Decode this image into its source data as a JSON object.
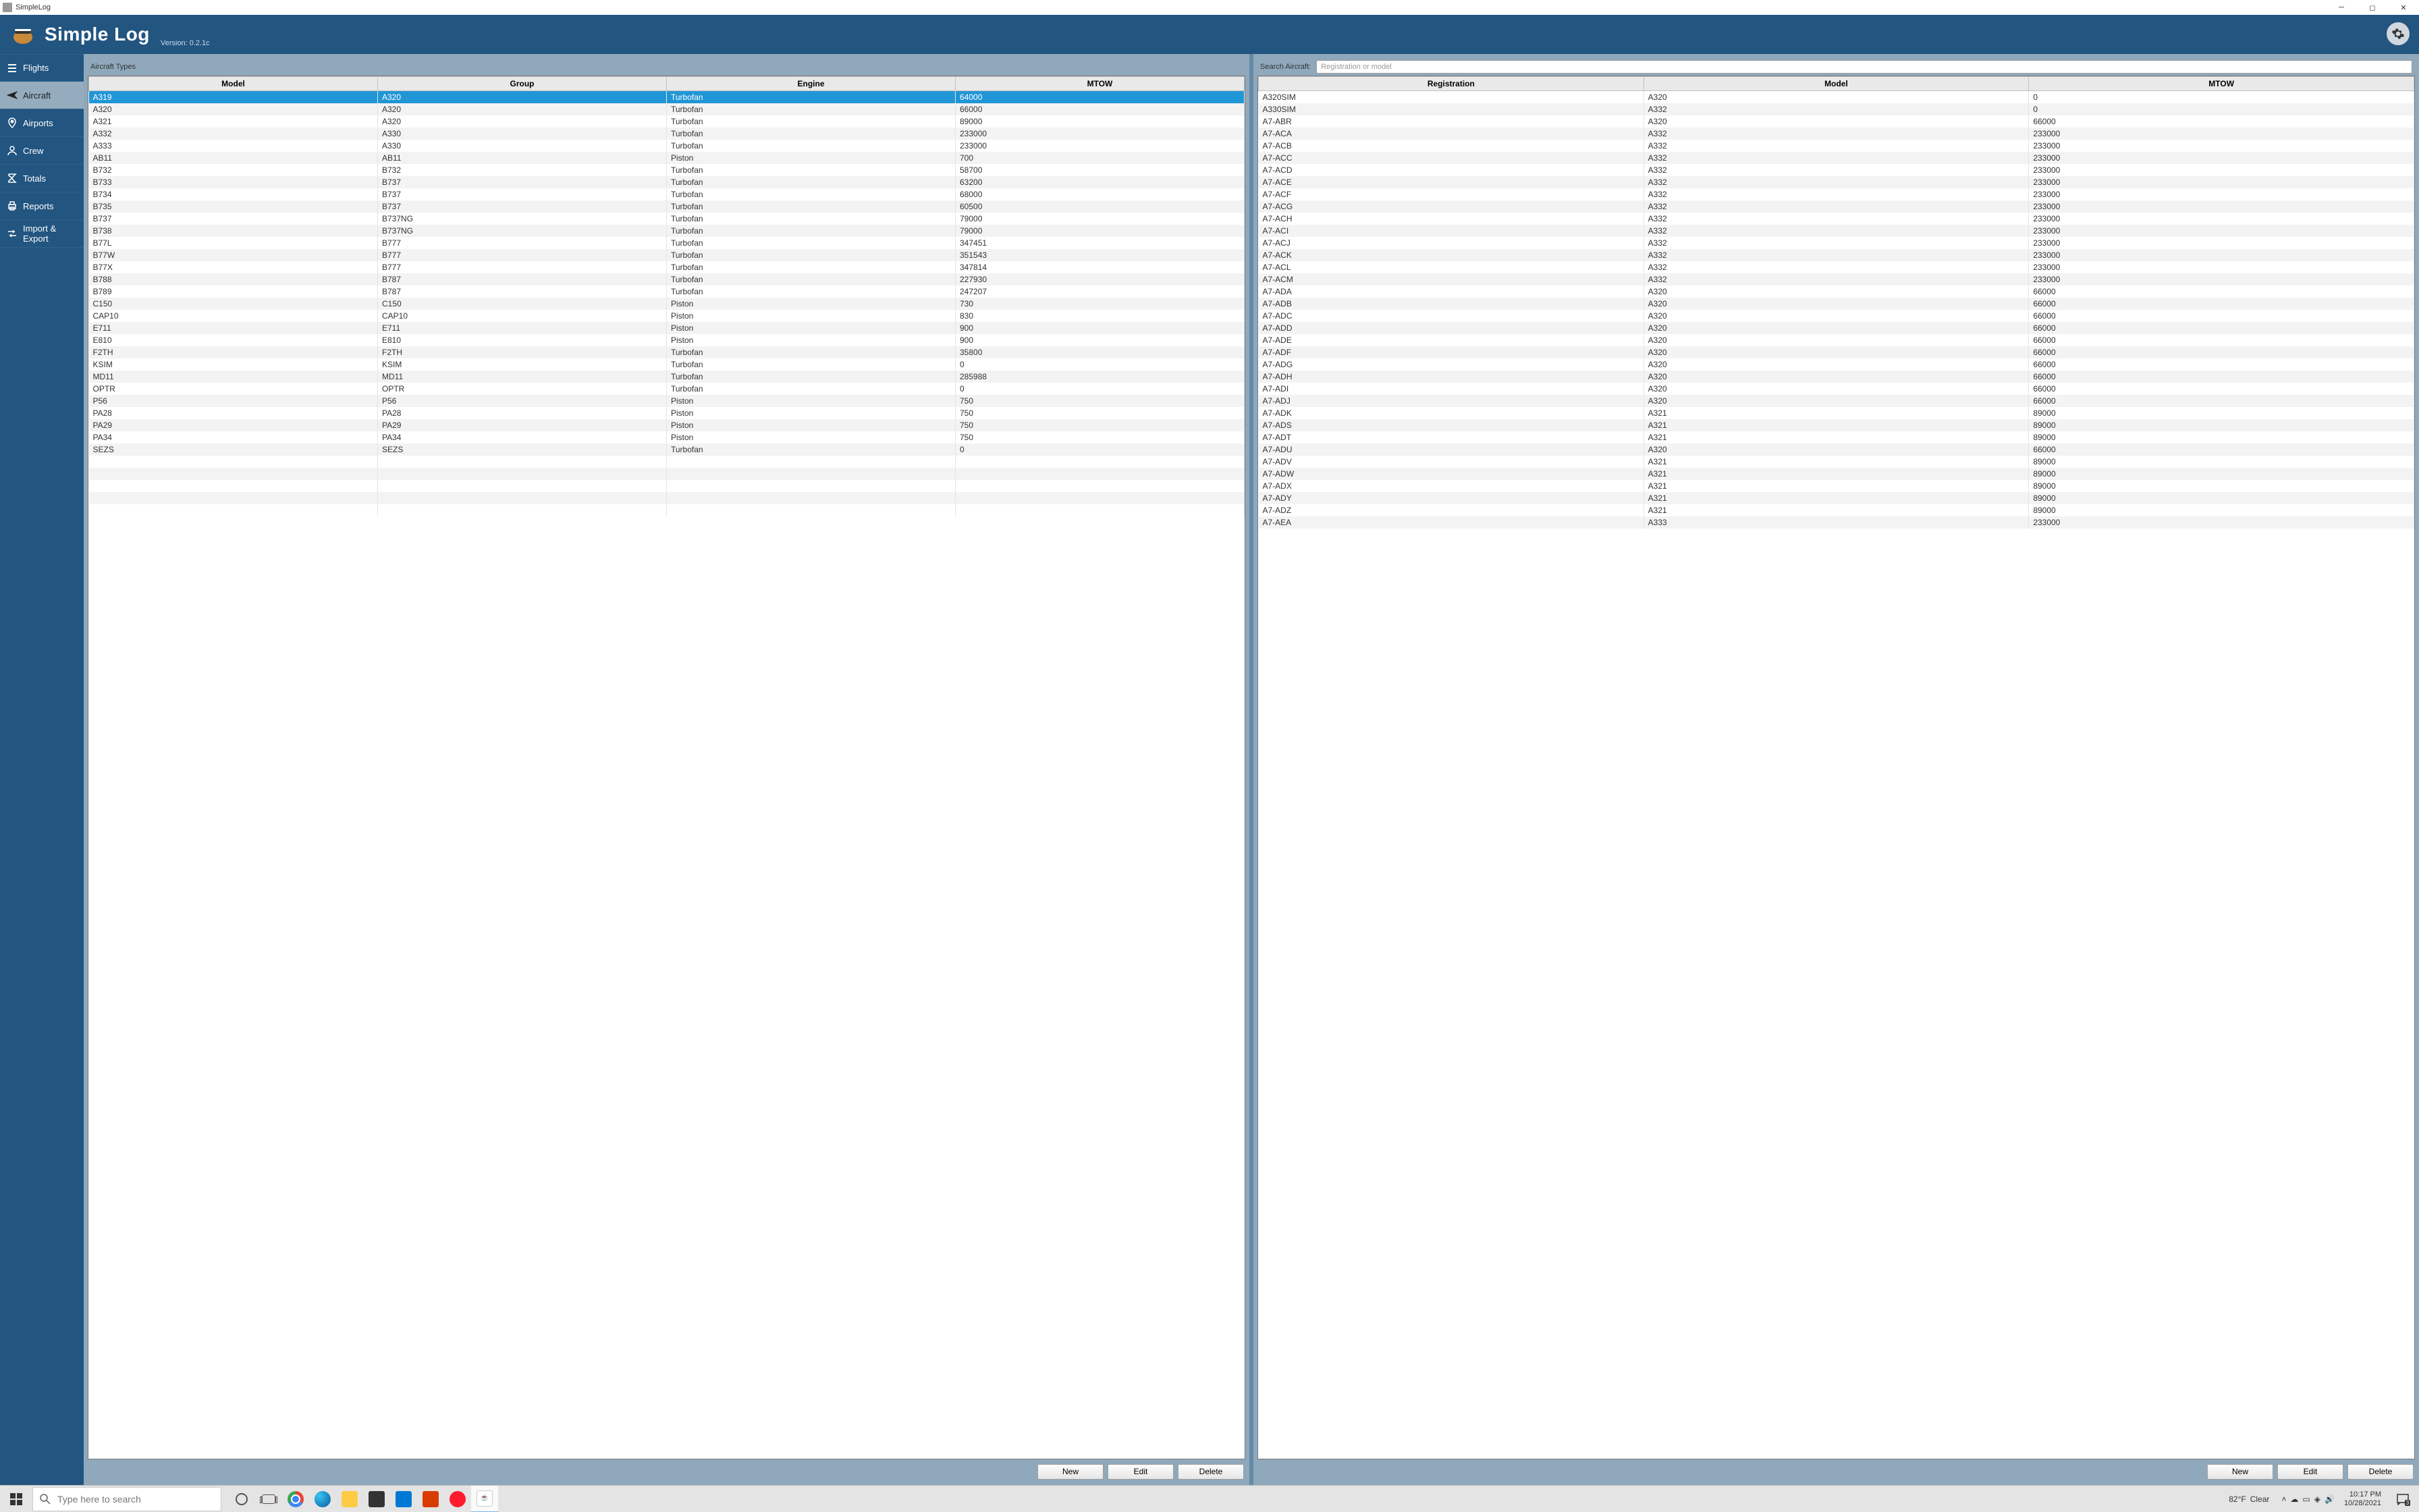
{
  "window": {
    "title": "SimpleLog"
  },
  "header": {
    "title": "Simple Log",
    "version": "Version: 0.2.1c"
  },
  "sidebar": {
    "items": [
      {
        "label": "Flights"
      },
      {
        "label": "Aircraft"
      },
      {
        "label": "Airports"
      },
      {
        "label": "Crew"
      },
      {
        "label": "Totals"
      },
      {
        "label": "Reports"
      },
      {
        "label": "Import & Export"
      }
    ],
    "active_index": 1
  },
  "left_panel": {
    "title": "Aircraft Types",
    "columns": [
      "Model",
      "Group",
      "Engine",
      "MTOW"
    ],
    "selected_index": 0,
    "rows": [
      [
        "A319",
        "A320",
        "Turbofan",
        "64000"
      ],
      [
        "A320",
        "A320",
        "Turbofan",
        "66000"
      ],
      [
        "A321",
        "A320",
        "Turbofan",
        "89000"
      ],
      [
        "A332",
        "A330",
        "Turbofan",
        "233000"
      ],
      [
        "A333",
        "A330",
        "Turbofan",
        "233000"
      ],
      [
        "AB11",
        "AB11",
        "Piston",
        "700"
      ],
      [
        "B732",
        "B732",
        "Turbofan",
        "58700"
      ],
      [
        "B733",
        "B737",
        "Turbofan",
        "63200"
      ],
      [
        "B734",
        "B737",
        "Turbofan",
        "68000"
      ],
      [
        "B735",
        "B737",
        "Turbofan",
        "60500"
      ],
      [
        "B737",
        "B737NG",
        "Turbofan",
        "79000"
      ],
      [
        "B738",
        "B737NG",
        "Turbofan",
        "79000"
      ],
      [
        "B77L",
        "B777",
        "Turbofan",
        "347451"
      ],
      [
        "B77W",
        "B777",
        "Turbofan",
        "351543"
      ],
      [
        "B77X",
        "B777",
        "Turbofan",
        "347814"
      ],
      [
        "B788",
        "B787",
        "Turbofan",
        "227930"
      ],
      [
        "B789",
        "B787",
        "Turbofan",
        "247207"
      ],
      [
        "C150",
        "C150",
        "Piston",
        "730"
      ],
      [
        "CAP10",
        "CAP10",
        "Piston",
        "830"
      ],
      [
        "E711",
        "E711",
        "Piston",
        "900"
      ],
      [
        "E810",
        "E810",
        "Piston",
        "900"
      ],
      [
        "F2TH",
        "F2TH",
        "Turbofan",
        "35800"
      ],
      [
        "KSIM",
        "KSIM",
        "Turbofan",
        "0"
      ],
      [
        "MD11",
        "MD11",
        "Turbofan",
        "285988"
      ],
      [
        "OPTR",
        "OPTR",
        "Turbofan",
        "0"
      ],
      [
        "P56",
        "P56",
        "Piston",
        "750"
      ],
      [
        "PA28",
        "PA28",
        "Piston",
        "750"
      ],
      [
        "PA29",
        "PA29",
        "Piston",
        "750"
      ],
      [
        "PA34",
        "PA34",
        "Piston",
        "750"
      ],
      [
        "SEZS",
        "SEZS",
        "Turbofan",
        "0"
      ]
    ],
    "empty_rows": 5,
    "buttons": {
      "new": "New",
      "edit": "Edit",
      "delete": "Delete"
    }
  },
  "right_panel": {
    "search_label": "Search Aircraft:",
    "search_placeholder": "Registration or model",
    "columns": [
      "Registration",
      "Model",
      "MTOW"
    ],
    "rows": [
      [
        "A320SIM",
        "A320",
        "0"
      ],
      [
        "A330SIM",
        "A332",
        "0"
      ],
      [
        "A7-ABR",
        "A320",
        "66000"
      ],
      [
        "A7-ACA",
        "A332",
        "233000"
      ],
      [
        "A7-ACB",
        "A332",
        "233000"
      ],
      [
        "A7-ACC",
        "A332",
        "233000"
      ],
      [
        "A7-ACD",
        "A332",
        "233000"
      ],
      [
        "A7-ACE",
        "A332",
        "233000"
      ],
      [
        "A7-ACF",
        "A332",
        "233000"
      ],
      [
        "A7-ACG",
        "A332",
        "233000"
      ],
      [
        "A7-ACH",
        "A332",
        "233000"
      ],
      [
        "A7-ACI",
        "A332",
        "233000"
      ],
      [
        "A7-ACJ",
        "A332",
        "233000"
      ],
      [
        "A7-ACK",
        "A332",
        "233000"
      ],
      [
        "A7-ACL",
        "A332",
        "233000"
      ],
      [
        "A7-ACM",
        "A332",
        "233000"
      ],
      [
        "A7-ADA",
        "A320",
        "66000"
      ],
      [
        "A7-ADB",
        "A320",
        "66000"
      ],
      [
        "A7-ADC",
        "A320",
        "66000"
      ],
      [
        "A7-ADD",
        "A320",
        "66000"
      ],
      [
        "A7-ADE",
        "A320",
        "66000"
      ],
      [
        "A7-ADF",
        "A320",
        "66000"
      ],
      [
        "A7-ADG",
        "A320",
        "66000"
      ],
      [
        "A7-ADH",
        "A320",
        "66000"
      ],
      [
        "A7-ADI",
        "A320",
        "66000"
      ],
      [
        "A7-ADJ",
        "A320",
        "66000"
      ],
      [
        "A7-ADK",
        "A321",
        "89000"
      ],
      [
        "A7-ADS",
        "A321",
        "89000"
      ],
      [
        "A7-ADT",
        "A321",
        "89000"
      ],
      [
        "A7-ADU",
        "A320",
        "66000"
      ],
      [
        "A7-ADV",
        "A321",
        "89000"
      ],
      [
        "A7-ADW",
        "A321",
        "89000"
      ],
      [
        "A7-ADX",
        "A321",
        "89000"
      ],
      [
        "A7-ADY",
        "A321",
        "89000"
      ],
      [
        "A7-ADZ",
        "A321",
        "89000"
      ],
      [
        "A7-AEA",
        "A333",
        "233000"
      ]
    ],
    "buttons": {
      "new": "New",
      "edit": "Edit",
      "delete": "Delete"
    }
  },
  "taskbar": {
    "search_placeholder": "Type here to search",
    "weather": {
      "temp": "82°F",
      "cond": "Clear"
    },
    "clock": {
      "time": "10:17 PM",
      "date": "10/28/2021"
    },
    "notif_count": "3"
  }
}
